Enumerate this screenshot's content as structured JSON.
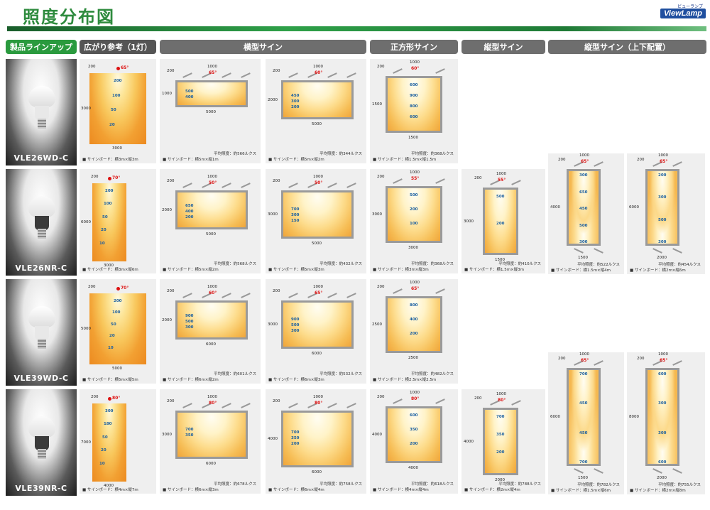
{
  "title": "照度分布図",
  "logo": {
    "jp": "ビューランプ",
    "en": "ViewLamp"
  },
  "headers": {
    "lineup": "製品ラインアップ",
    "spread": "広がり参考（1灯）",
    "horizontal": "横型サイン",
    "square": "正方形サイン",
    "vertical": "縦型サイン",
    "vertical_tb": "縦型サイン（上下配置）"
  },
  "products": [
    {
      "name": "VLE26WD-C",
      "style": "white"
    },
    {
      "name": "VLE26NR-C",
      "style": "dark"
    },
    {
      "name": "VLE39WD-C",
      "style": "white"
    },
    {
      "name": "VLE39NR-C",
      "style": "dark"
    }
  ],
  "rows": [
    {
      "spread": {
        "angle": "65°",
        "dist": "200",
        "w": "3000",
        "h": "3000",
        "levels": [
          "200",
          "100",
          "50",
          "20"
        ],
        "caption": "サインボード：横3m×縦3m"
      },
      "cells": [
        {
          "col": 2,
          "type": "h",
          "angle": "65°",
          "spacing": "1000",
          "off": "200",
          "w": "5000",
          "h": "1000",
          "levels": [
            "500",
            "400"
          ],
          "avg": "平均照度：約566ルクス",
          "caption": "サインボード：横5m×縦1m"
        },
        {
          "col": 3,
          "type": "h",
          "angle": "60°",
          "spacing": "1000",
          "off": "200",
          "w": "5000",
          "h": "2000",
          "levels": [
            "450",
            "300",
            "200"
          ],
          "avg": "平均照度：約344ルクス",
          "caption": "サインボード：横5m×縦2m"
        },
        {
          "col": 4,
          "type": "s",
          "angle": "60°",
          "spacing": "1000",
          "off": "200",
          "w": "1500",
          "h": "1500",
          "levels": [
            "600",
            "900",
            "800",
            "600"
          ],
          "avg": "平均照度：約368ルクス",
          "caption": "サインボード：横1.5m×縦1.5m"
        }
      ]
    },
    {
      "spread": {
        "angle": "70°",
        "dist": "200",
        "w": "3000",
        "h": "6000",
        "levels": [
          "200",
          "100",
          "50",
          "20",
          "10"
        ],
        "caption": "サインボード：横3m×縦6m"
      },
      "cells": [
        {
          "col": 2,
          "type": "h",
          "angle": "50°",
          "spacing": "1000",
          "off": "200",
          "w": "5000",
          "h": "2000",
          "levels": [
            "650",
            "400",
            "200"
          ],
          "avg": "平均照度：約568ルクス",
          "caption": "サインボード：横5m×縦2m"
        },
        {
          "col": 3,
          "type": "h",
          "angle": "50°",
          "spacing": "1000",
          "off": "200",
          "w": "5000",
          "h": "3000",
          "levels": [
            "700",
            "300",
            "150"
          ],
          "avg": "平均照度：約432ルクス",
          "caption": "サインボード：横5m×縦3m"
        },
        {
          "col": 4,
          "type": "s",
          "angle": "55°",
          "spacing": "1000",
          "off": "200",
          "w": "3000",
          "h": "3000",
          "levels": [
            "500",
            "200",
            "100"
          ],
          "avg": "平均照度：約368ルクス",
          "caption": "サインボード：横3m×縦3m"
        },
        {
          "col": 5,
          "type": "v",
          "angle": "55°",
          "spacing": "1000",
          "off": "200",
          "w": "1500",
          "h": "3000",
          "levels": [
            "500",
            "200"
          ],
          "avg": "平均照度：約410ルクス",
          "caption": "サインボード：横1.5m×縦3m"
        },
        {
          "col": 6,
          "type": "tb",
          "angle": "65°",
          "spacing": "1000",
          "off": "200",
          "w": "1500",
          "h": "4000",
          "levels": [
            "300",
            "650",
            "450",
            "500",
            "300"
          ],
          "avg": "平均照度：約522ルクス",
          "caption": "サインボード：横1.5m×縦4m"
        },
        {
          "col": 7,
          "type": "tb",
          "angle": "65°",
          "spacing": "1000",
          "off": "200",
          "w": "2000",
          "h": "6000",
          "levels": [
            "200",
            "300",
            "500",
            "300"
          ],
          "avg": "平均照度：約454ルクス",
          "caption": "サインボード：横2m×縦6m"
        }
      ]
    },
    {
      "spread": {
        "angle": "70°",
        "dist": "200",
        "w": "5000",
        "h": "5000",
        "levels": [
          "200",
          "100",
          "50",
          "20",
          "10"
        ],
        "caption": "サインボード：横5m×縦5m"
      },
      "cells": [
        {
          "col": 2,
          "type": "h",
          "angle": "60°",
          "spacing": "1000",
          "off": "200",
          "w": "6000",
          "h": "2000",
          "levels": [
            "900",
            "500",
            "300"
          ],
          "avg": "平均照度：約601ルクス",
          "caption": "サインボード：横6m×縦2m"
        },
        {
          "col": 3,
          "type": "h",
          "angle": "65°",
          "spacing": "1000",
          "off": "200",
          "w": "6000",
          "h": "3000",
          "levels": [
            "900",
            "500",
            "300"
          ],
          "avg": "平均照度：約532ルクス",
          "caption": "サインボード：横6m×縦3m"
        },
        {
          "col": 4,
          "type": "s",
          "angle": "65°",
          "spacing": "1000",
          "off": "200",
          "w": "2500",
          "h": "2500",
          "levels": [
            "800",
            "400",
            "200"
          ],
          "avg": "平均照度：約482ルクス",
          "caption": "サインボード：横2.5m×縦2.5m"
        }
      ]
    },
    {
      "spread": {
        "angle": "80°",
        "dist": "200",
        "w": "4000",
        "h": "7000",
        "levels": [
          "300",
          "180",
          "50",
          "20",
          "10"
        ],
        "caption": "サインボード：横4m×縦7m"
      },
      "cells": [
        {
          "col": 2,
          "type": "h",
          "angle": "80°",
          "spacing": "1000",
          "off": "200",
          "w": "6000",
          "h": "3000",
          "levels": [
            "700",
            "350"
          ],
          "avg": "平均照度：約678ルクス",
          "caption": "サインボード：横6m×縦3m"
        },
        {
          "col": 3,
          "type": "h",
          "angle": "80°",
          "spacing": "1000",
          "off": "200",
          "w": "6000",
          "h": "4000",
          "levels": [
            "700",
            "350",
            "200"
          ],
          "avg": "平均照度：約758ルクス",
          "caption": "サインボード：横6m×縦4m"
        },
        {
          "col": 4,
          "type": "s",
          "angle": "80°",
          "spacing": "1000",
          "off": "200",
          "w": "4000",
          "h": "4000",
          "levels": [
            "600",
            "350",
            "200"
          ],
          "avg": "平均照度：約618ルクス",
          "caption": "サインボード：横4m×縦4m"
        },
        {
          "col": 5,
          "type": "v",
          "angle": "80°",
          "spacing": "1000",
          "off": "200",
          "w": "2000",
          "h": "4000",
          "levels": [
            "700",
            "350",
            "200"
          ],
          "avg": "平均照度：約788ルクス",
          "caption": "サインボード：横2m×縦4m"
        },
        {
          "col": 6,
          "type": "tb",
          "angle": "65°",
          "spacing": "1000",
          "off": "200",
          "w": "1500",
          "h": "6000",
          "levels": [
            "700",
            "450",
            "450",
            "700"
          ],
          "avg": "平均照度：約782ルクス",
          "caption": "サインボード：横1.5m×縦6m"
        },
        {
          "col": 7,
          "type": "tb",
          "angle": "65°",
          "spacing": "1000",
          "off": "200",
          "w": "2000",
          "h": "8000",
          "levels": [
            "600",
            "300",
            "300",
            "600"
          ],
          "avg": "平均照度：約755ルクス",
          "caption": "サインボード：横2m×縦8m"
        }
      ]
    }
  ]
}
